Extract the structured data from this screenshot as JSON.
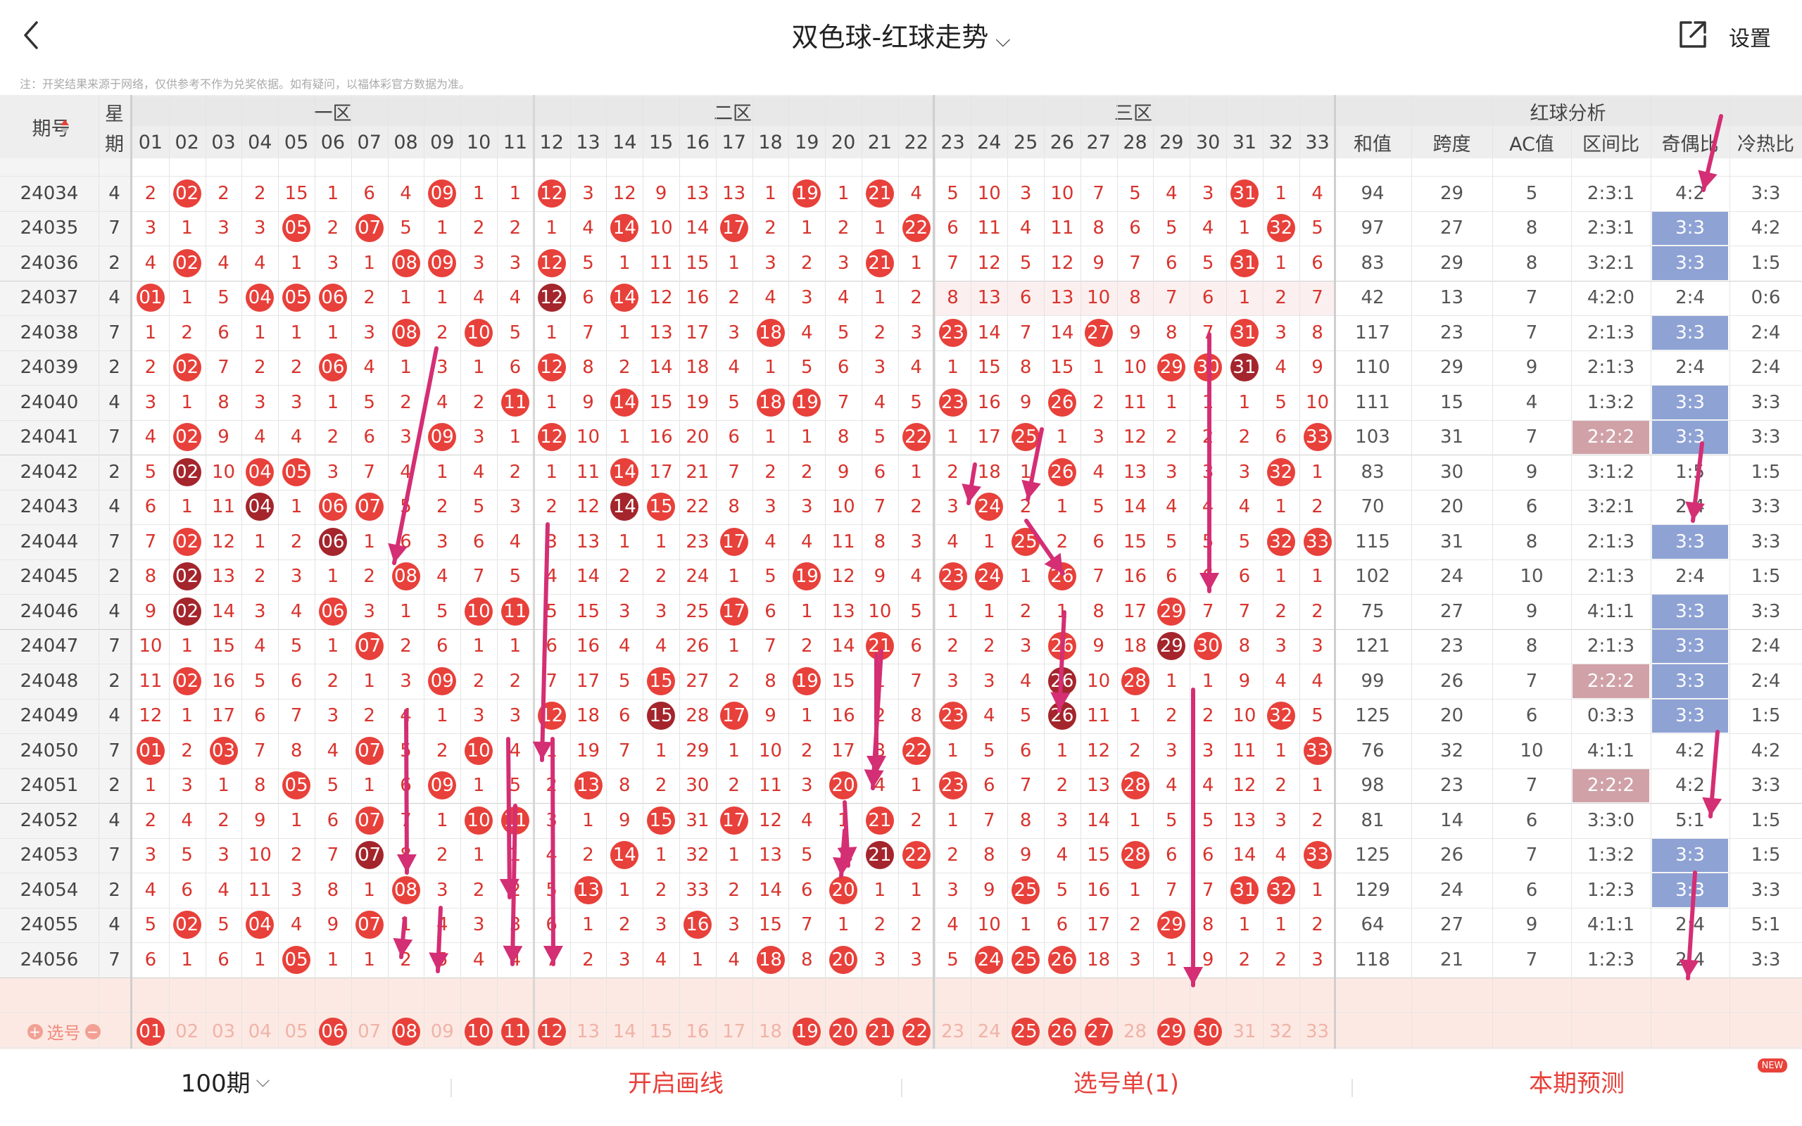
{
  "header": {
    "title": "双色球-红球走势",
    "settings": "设置"
  },
  "note": "注：开奖结果来源于网络，仅供参考不作为兑奖依据。如有疑问，以福体彩官方数据为准。",
  "zones": [
    "一区",
    "二区",
    "三区"
  ],
  "analysis_title": "红球分析",
  "col_headers": {
    "period": "期号",
    "week_top": "星",
    "week_bottom": "期",
    "numbers": [
      "01",
      "02",
      "03",
      "04",
      "05",
      "06",
      "07",
      "08",
      "09",
      "10",
      "11",
      "12",
      "13",
      "14",
      "15",
      "16",
      "17",
      "18",
      "19",
      "20",
      "21",
      "22",
      "23",
      "24",
      "25",
      "26",
      "27",
      "28",
      "29",
      "30",
      "31",
      "32",
      "33"
    ],
    "analysis": [
      "和值",
      "跨度",
      "AC值",
      "区间比",
      "奇偶比",
      "冷热比"
    ]
  },
  "selector_label": "选号",
  "bottom": {
    "period_count": "100期",
    "draw_line": "开启画线",
    "pick_list": "选号单(1)",
    "predict": "本期预测",
    "new_badge": "NEW"
  },
  "colors": {
    "red": "#e8403a",
    "dark_red": "#a4252c",
    "blue_hl": "#8ea2d4",
    "pink_hl": "#d0a2a8",
    "arrow": "#d42e74",
    "pick_bg": "#fde9e3"
  },
  "rows": [
    {
      "p": "24034",
      "w": "4",
      "n": [
        2,
        "02",
        2,
        2,
        15,
        1,
        6,
        4,
        "09",
        1,
        1,
        "12",
        3,
        12,
        9,
        13,
        13,
        1,
        "19",
        1,
        "21",
        4,
        5,
        10,
        3,
        10,
        7,
        5,
        4,
        3,
        "31",
        1,
        4
      ],
      "a": [
        "94",
        "29",
        "5",
        "2:3:1",
        "4:2",
        "3:3"
      ]
    },
    {
      "p": "24035",
      "w": "7",
      "n": [
        3,
        1,
        3,
        3,
        "05",
        2,
        "07",
        5,
        1,
        2,
        2,
        1,
        4,
        "14",
        10,
        14,
        "17",
        2,
        1,
        2,
        1,
        "22",
        6,
        11,
        4,
        11,
        8,
        6,
        5,
        4,
        1,
        "32",
        5
      ],
      "a": [
        "97",
        "27",
        "8",
        "2:3:1",
        "3:3",
        "4:2"
      ]
    },
    {
      "p": "24036",
      "w": "2",
      "n": [
        4,
        "02",
        4,
        4,
        1,
        3,
        1,
        "08",
        "09",
        3,
        3,
        "12",
        5,
        1,
        11,
        15,
        1,
        3,
        2,
        3,
        "21",
        1,
        7,
        12,
        5,
        12,
        9,
        7,
        6,
        5,
        "31",
        1,
        6
      ],
      "a": [
        "83",
        "29",
        "8",
        "3:2:1",
        "3:3",
        "1:5"
      ]
    },
    {
      "p": "24037",
      "w": "4",
      "n": [
        "01",
        1,
        5,
        "04",
        "05",
        "06",
        2,
        1,
        1,
        4,
        4,
        "12",
        6,
        "14",
        12,
        16,
        2,
        4,
        3,
        4,
        1,
        2,
        8,
        13,
        6,
        13,
        10,
        8,
        7,
        6,
        1,
        2,
        7
      ],
      "a": [
        "42",
        "13",
        "7",
        "4:2:0",
        "2:4",
        "0:6"
      ]
    },
    {
      "p": "24038",
      "w": "7",
      "n": [
        1,
        2,
        6,
        1,
        1,
        1,
        3,
        "08",
        2,
        "10",
        5,
        1,
        7,
        1,
        13,
        17,
        3,
        "18",
        4,
        5,
        2,
        3,
        "23",
        14,
        7,
        14,
        "27",
        9,
        8,
        7,
        "31",
        3,
        8
      ],
      "a": [
        "117",
        "23",
        "7",
        "2:1:3",
        "3:3",
        "2:4"
      ]
    },
    {
      "p": "24039",
      "w": "2",
      "n": [
        2,
        "02",
        7,
        2,
        2,
        "06",
        4,
        1,
        3,
        1,
        6,
        "12",
        8,
        2,
        14,
        18,
        4,
        1,
        5,
        6,
        3,
        4,
        1,
        15,
        8,
        15,
        1,
        10,
        "29",
        "30",
        "31",
        4,
        9
      ],
      "a": [
        "110",
        "29",
        "9",
        "2:1:3",
        "2:4",
        "2:4"
      ]
    },
    {
      "p": "24040",
      "w": "4",
      "n": [
        3,
        1,
        8,
        3,
        3,
        1,
        5,
        2,
        4,
        2,
        "11",
        1,
        9,
        "14",
        15,
        19,
        5,
        "18",
        "19",
        7,
        4,
        5,
        "23",
        16,
        9,
        "26",
        2,
        11,
        1,
        1,
        1,
        5,
        10
      ],
      "a": [
        "111",
        "15",
        "4",
        "1:3:2",
        "3:3",
        "3:3"
      ]
    },
    {
      "p": "24041",
      "w": "7",
      "n": [
        4,
        "02",
        9,
        4,
        4,
        2,
        6,
        3,
        "09",
        3,
        1,
        "12",
        10,
        1,
        16,
        20,
        6,
        1,
        1,
        8,
        5,
        "22",
        1,
        17,
        "25",
        1,
        3,
        12,
        2,
        2,
        2,
        6,
        "33"
      ],
      "a": [
        "103",
        "31",
        "7",
        "2:2:2",
        "3:3",
        "3:3"
      ]
    },
    {
      "p": "24042",
      "w": "2",
      "n": [
        5,
        "02",
        10,
        "04",
        "05",
        3,
        7,
        4,
        1,
        4,
        2,
        1,
        11,
        "14",
        17,
        21,
        7,
        2,
        2,
        9,
        6,
        1,
        2,
        18,
        1,
        "26",
        4,
        13,
        3,
        3,
        3,
        "32",
        1
      ],
      "a": [
        "83",
        "30",
        "9",
        "3:1:2",
        "1:5",
        "1:5"
      ]
    },
    {
      "p": "24043",
      "w": "4",
      "n": [
        6,
        1,
        11,
        "04",
        1,
        "06",
        "07",
        5,
        2,
        5,
        3,
        2,
        12,
        "14",
        "15",
        22,
        8,
        3,
        3,
        10,
        7,
        2,
        3,
        "24",
        2,
        1,
        5,
        14,
        4,
        4,
        4,
        1,
        2
      ],
      "a": [
        "70",
        "20",
        "6",
        "3:2:1",
        "2:4",
        "3:3"
      ]
    },
    {
      "p": "24044",
      "w": "7",
      "n": [
        7,
        "02",
        12,
        1,
        2,
        "06",
        1,
        6,
        3,
        6,
        4,
        3,
        13,
        1,
        1,
        23,
        "17",
        4,
        4,
        11,
        8,
        3,
        4,
        1,
        "25",
        2,
        6,
        15,
        5,
        5,
        5,
        "32",
        "33"
      ],
      "a": [
        "115",
        "31",
        "8",
        "2:1:3",
        "3:3",
        "3:3"
      ]
    },
    {
      "p": "24045",
      "w": "2",
      "n": [
        8,
        "02",
        13,
        2,
        3,
        1,
        2,
        "08",
        4,
        7,
        5,
        4,
        14,
        2,
        2,
        24,
        1,
        5,
        "19",
        12,
        9,
        4,
        "23",
        "24",
        1,
        "26",
        7,
        16,
        6,
        6,
        6,
        1,
        1
      ],
      "a": [
        "102",
        "24",
        "10",
        "2:1:3",
        "2:4",
        "1:5"
      ]
    },
    {
      "p": "24046",
      "w": "4",
      "n": [
        9,
        "02",
        14,
        3,
        4,
        "06",
        3,
        1,
        5,
        "10",
        "11",
        5,
        15,
        3,
        3,
        25,
        "17",
        6,
        1,
        13,
        10,
        5,
        1,
        1,
        2,
        1,
        8,
        17,
        "29",
        7,
        7,
        2,
        2
      ],
      "a": [
        "75",
        "27",
        "9",
        "4:1:1",
        "3:3",
        "3:3"
      ]
    },
    {
      "p": "24047",
      "w": "7",
      "n": [
        10,
        1,
        15,
        4,
        5,
        1,
        "07",
        2,
        6,
        1,
        1,
        6,
        16,
        4,
        4,
        26,
        1,
        7,
        2,
        14,
        "21",
        6,
        2,
        2,
        3,
        "26",
        9,
        18,
        "29",
        "30",
        8,
        3,
        3
      ],
      "a": [
        "121",
        "23",
        "8",
        "2:1:3",
        "3:3",
        "2:4"
      ]
    },
    {
      "p": "24048",
      "w": "2",
      "n": [
        11,
        "02",
        16,
        5,
        6,
        2,
        1,
        3,
        "09",
        2,
        2,
        7,
        17,
        5,
        "15",
        27,
        2,
        8,
        "19",
        15,
        1,
        7,
        3,
        3,
        4,
        "26",
        10,
        "28",
        1,
        1,
        9,
        4,
        4
      ],
      "a": [
        "99",
        "26",
        "7",
        "2:2:2",
        "3:3",
        "2:4"
      ]
    },
    {
      "p": "24049",
      "w": "4",
      "n": [
        12,
        1,
        17,
        6,
        7,
        3,
        2,
        4,
        1,
        3,
        3,
        "12",
        18,
        6,
        "15",
        28,
        "17",
        9,
        1,
        16,
        2,
        8,
        "23",
        4,
        5,
        "26",
        11,
        1,
        2,
        2,
        10,
        "32",
        5
      ],
      "a": [
        "125",
        "20",
        "6",
        "0:3:3",
        "3:3",
        "1:5"
      ]
    },
    {
      "p": "24050",
      "w": "7",
      "n": [
        "01",
        2,
        "03",
        7,
        8,
        4,
        "07",
        5,
        2,
        "10",
        4,
        1,
        19,
        7,
        1,
        29,
        1,
        10,
        2,
        17,
        3,
        "22",
        1,
        5,
        6,
        1,
        12,
        2,
        3,
        3,
        11,
        1,
        "33"
      ],
      "a": [
        "76",
        "32",
        "10",
        "4:1:1",
        "4:2",
        "4:2"
      ]
    },
    {
      "p": "24051",
      "w": "2",
      "n": [
        1,
        3,
        1,
        8,
        "05",
        5,
        1,
        6,
        "09",
        1,
        5,
        2,
        "13",
        8,
        2,
        30,
        2,
        11,
        3,
        "20",
        4,
        1,
        "23",
        6,
        7,
        2,
        13,
        "28",
        4,
        4,
        12,
        2,
        1
      ],
      "a": [
        "98",
        "23",
        "7",
        "2:2:2",
        "4:2",
        "3:3"
      ]
    },
    {
      "p": "24052",
      "w": "4",
      "n": [
        2,
        4,
        2,
        9,
        1,
        6,
        "07",
        7,
        1,
        "10",
        "11",
        3,
        1,
        9,
        "15",
        31,
        "17",
        12,
        4,
        1,
        "21",
        2,
        1,
        7,
        8,
        3,
        14,
        1,
        5,
        5,
        13,
        3,
        2
      ],
      "a": [
        "81",
        "14",
        "6",
        "3:3:0",
        "5:1",
        "1:5"
      ]
    },
    {
      "p": "24053",
      "w": "7",
      "n": [
        3,
        5,
        3,
        10,
        2,
        7,
        "07",
        8,
        2,
        1,
        1,
        4,
        2,
        "14",
        1,
        32,
        1,
        13,
        5,
        2,
        "21",
        "22",
        2,
        8,
        9,
        4,
        15,
        "28",
        6,
        6,
        14,
        4,
        "33"
      ],
      "a": [
        "125",
        "26",
        "7",
        "1:3:2",
        "3:3",
        "1:5"
      ]
    },
    {
      "p": "24054",
      "w": "2",
      "n": [
        4,
        6,
        4,
        11,
        3,
        8,
        1,
        "08",
        3,
        2,
        2,
        5,
        "13",
        1,
        2,
        33,
        2,
        14,
        6,
        "20",
        1,
        1,
        3,
        9,
        "25",
        5,
        16,
        1,
        7,
        7,
        "31",
        "32",
        1
      ],
      "a": [
        "129",
        "24",
        "6",
        "1:2:3",
        "3:3",
        "3:3"
      ]
    },
    {
      "p": "24055",
      "w": "4",
      "n": [
        5,
        "02",
        5,
        "04",
        4,
        9,
        "07",
        1,
        4,
        3,
        3,
        6,
        1,
        2,
        3,
        "16",
        3,
        15,
        7,
        1,
        2,
        2,
        4,
        10,
        1,
        6,
        17,
        2,
        "29",
        8,
        1,
        1,
        2
      ],
      "a": [
        "64",
        "27",
        "9",
        "4:1:1",
        "2:4",
        "5:1"
      ]
    },
    {
      "p": "24056",
      "w": "7",
      "n": [
        6,
        1,
        6,
        1,
        "05",
        1,
        1,
        2,
        5,
        4,
        4,
        7,
        2,
        3,
        4,
        1,
        4,
        "18",
        8,
        "20",
        3,
        3,
        5,
        "24",
        "25",
        "26",
        18,
        3,
        1,
        9,
        2,
        2,
        3
      ],
      "a": [
        "118",
        "21",
        "7",
        "1:2:3",
        "2:4",
        "3:3"
      ]
    }
  ],
  "selected_numbers": [
    "01",
    "06",
    "08",
    "10",
    "11",
    "12",
    "19",
    "20",
    "21",
    "22",
    "25",
    "26",
    "27",
    "29",
    "30"
  ],
  "highlights": {
    "blue": [
      [
        1,
        4
      ],
      [
        2,
        4
      ],
      [
        4,
        4
      ],
      [
        6,
        4
      ],
      [
        7,
        4
      ],
      [
        10,
        4
      ],
      [
        12,
        4
      ],
      [
        13,
        4
      ],
      [
        14,
        4
      ],
      [
        15,
        4
      ],
      [
        19,
        4
      ],
      [
        20,
        4
      ]
    ],
    "pink": [
      [
        7,
        3
      ],
      [
        14,
        3
      ],
      [
        17,
        3
      ]
    ]
  },
  "arrows": [
    [
      620,
      495,
      560,
      800
    ],
    [
      1718,
      475,
      1718,
      840
    ],
    [
      2445,
      165,
      2420,
      270
    ],
    [
      2418,
      630,
      2405,
      740
    ],
    [
      2440,
      1040,
      2430,
      1160
    ],
    [
      2408,
      1240,
      2398,
      1390
    ],
    [
      1480,
      610,
      1460,
      710
    ],
    [
      1458,
      740,
      1510,
      815
    ],
    [
      1512,
      870,
      1505,
      1010
    ],
    [
      778,
      745,
      770,
      1080
    ],
    [
      722,
      1050,
      724,
      1275
    ],
    [
      785,
      1050,
      786,
      1370
    ],
    [
      1695,
      980,
      1695,
      1400
    ],
    [
      1252,
      925,
      1240,
      1120
    ],
    [
      1245,
      930,
      1245,
      1100
    ],
    [
      577,
      1010,
      578,
      1240
    ],
    [
      626,
      1290,
      622,
      1380
    ],
    [
      575,
      1305,
      570,
      1360
    ],
    [
      732,
      1145,
      728,
      1370
    ],
    [
      1200,
      1140,
      1205,
      1230
    ],
    [
      1200,
      1180,
      1195,
      1245
    ],
    [
      2070,
      1510,
      2045,
      1510
    ],
    [
      1385,
      660,
      1376,
      715
    ]
  ]
}
